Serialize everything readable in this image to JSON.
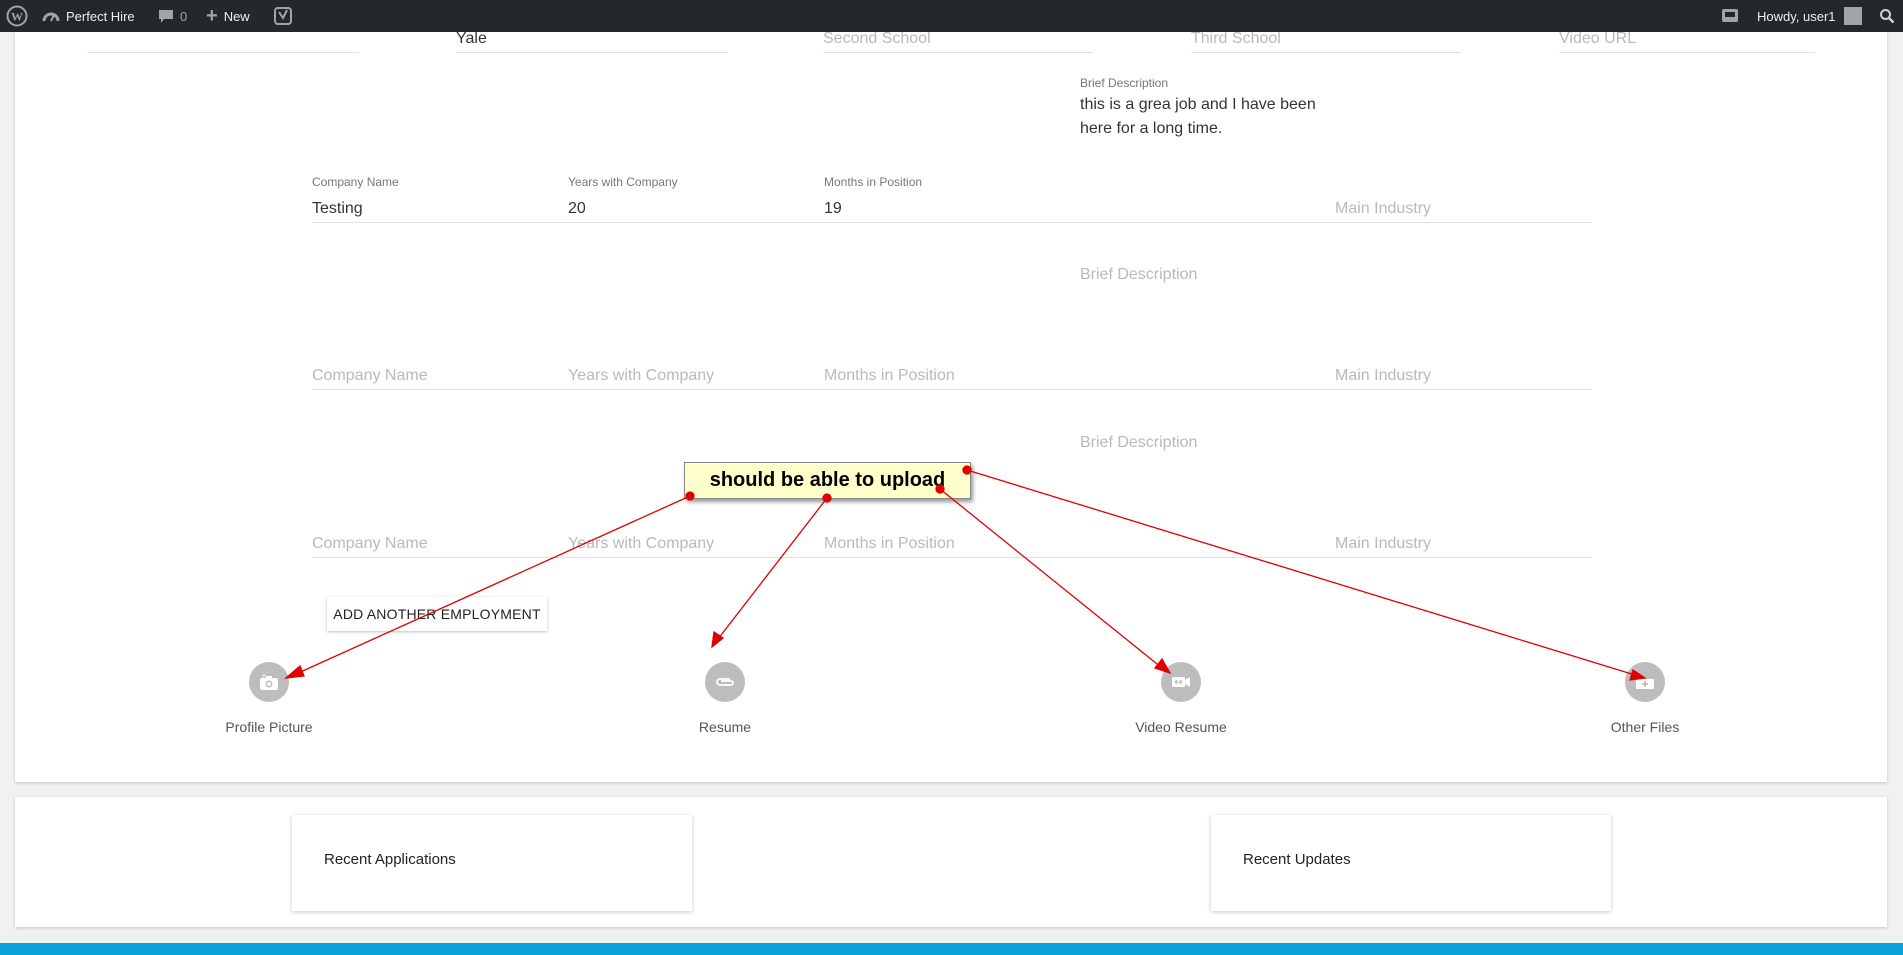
{
  "admin_bar": {
    "site_name": "Perfect Hire",
    "comments_count": "0",
    "new_label": "New",
    "greeting": "Howdy, user1"
  },
  "education": {
    "school_value": "Yale",
    "second_school_placeholder": "Second School",
    "third_school_placeholder": "Third School",
    "video_url_placeholder": "Video URL"
  },
  "employment": [
    {
      "company_label": "Company Name",
      "company_value": "Testing",
      "years_label": "Years with Company",
      "years_value": "20",
      "months_label": "Months in Position",
      "months_value": "19",
      "industry_placeholder": "Main Industry",
      "description_label": "Brief Description",
      "description_value": "this is a grea job and I have been here for a long time."
    },
    {
      "company_placeholder": "Company Name",
      "years_placeholder": "Years with Company",
      "months_placeholder": "Months in Position",
      "industry_placeholder": "Main Industry",
      "description_placeholder": "Brief Description"
    },
    {
      "company_placeholder": "Company Name",
      "years_placeholder": "Years with Company",
      "months_placeholder": "Months in Position",
      "industry_placeholder": "Main Industry",
      "description_placeholder": "Brief Description"
    }
  ],
  "add_employment_label": "ADD ANOTHER EMPLOYMENT",
  "uploads": {
    "profile_picture": "Profile Picture",
    "resume": "Resume",
    "video_resume": "Video Resume",
    "other_files": "Other Files"
  },
  "panels": {
    "recent_applications": "Recent Applications",
    "recent_updates": "Recent Updates"
  },
  "annotation": "should be able to upload",
  "colors": {
    "admin_bar": "#23282d",
    "accent_footer": "#0aa3dc",
    "arrow": "#e00000",
    "note_bg": "#ffffcc"
  }
}
